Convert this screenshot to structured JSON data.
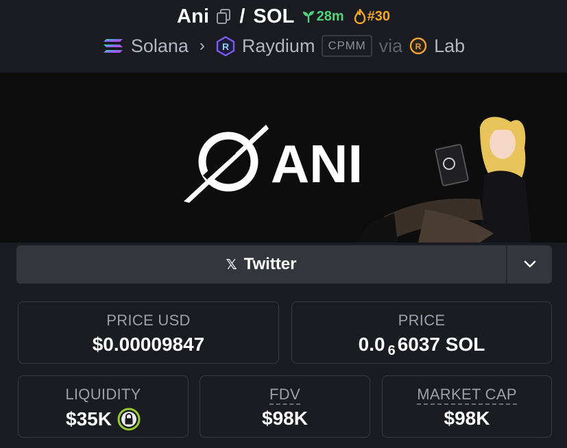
{
  "header": {
    "token_symbol": "Ani",
    "separator": "/",
    "quote_symbol": "SOL",
    "age": "28m",
    "rank": "#30",
    "chain": "Solana",
    "dex": "Raydium",
    "pool_type": "CPMM",
    "via_label": "via",
    "launchpad": "Lab"
  },
  "banner": {
    "logo_text": "ANI"
  },
  "social": {
    "twitter_label": "Twitter"
  },
  "stats": {
    "price_usd": {
      "label": "PRICE USD",
      "value": "$0.00009847"
    },
    "price": {
      "label": "PRICE",
      "value_prefix": "0.0",
      "value_sub": "6",
      "value_suffix": "6037 SOL"
    },
    "liquidity": {
      "label": "LIQUIDITY",
      "value": "$35K"
    },
    "fdv": {
      "label": "FDV",
      "value": "$98K"
    },
    "market_cap": {
      "label": "MARKET CAP",
      "value": "$98K"
    }
  },
  "colors": {
    "background": "#1b1c22",
    "card_border": "#3a3b43",
    "age_green": "#50d27a",
    "rank_orange": "#f5a623",
    "lock_green": "#9acd32"
  }
}
